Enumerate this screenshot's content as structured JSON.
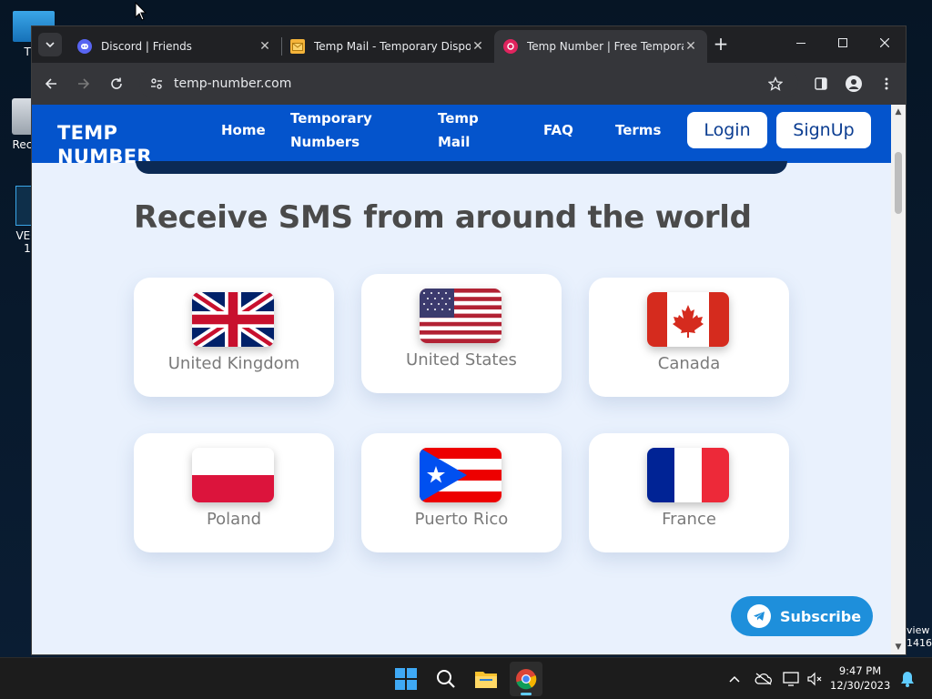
{
  "desktop": {
    "icons": [
      {
        "label": "Th"
      },
      {
        "label": "Recy"
      },
      {
        "label": "VEG"
      },
      {
        "label": "1"
      }
    ],
    "side_text": [
      "view",
      "1416"
    ]
  },
  "browser": {
    "tabs": [
      {
        "title": "Discord | Friends",
        "icon": "discord-icon",
        "color": "#5865F2"
      },
      {
        "title": "Temp Mail - Temporary Dispos",
        "icon": "mail-icon",
        "color": "#f4b43a"
      },
      {
        "title": "Temp Number | Free Temporar",
        "icon": "temp-number-icon",
        "color": "#e0245e",
        "active": true
      }
    ],
    "url": "temp-number.com"
  },
  "site": {
    "logo": "TEMP NUMBER",
    "nav": {
      "home": "Home",
      "temporary_numbers": "Temporary Numbers",
      "temp_mail": "Temp Mail",
      "faq": "FAQ",
      "terms": "Terms",
      "login": "Login",
      "signup": "SignUp"
    },
    "heading": "Receive SMS from around the world",
    "countries": [
      {
        "name": "United Kingdom",
        "flag": "uk-flag"
      },
      {
        "name": "United States",
        "flag": "us-flag"
      },
      {
        "name": "Canada",
        "flag": "canada-flag"
      },
      {
        "name": "Poland",
        "flag": "poland-flag"
      },
      {
        "name": "Puerto Rico",
        "flag": "puerto-rico-flag"
      },
      {
        "name": "France",
        "flag": "france-flag"
      }
    ],
    "subscribe": "Subscribe"
  },
  "taskbar": {
    "time": "9:47 PM",
    "date": "12/30/2023"
  }
}
